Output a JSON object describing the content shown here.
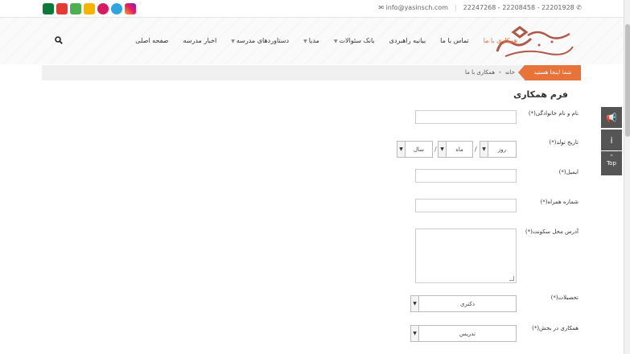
{
  "topbar": {
    "phones": "22247268 - 22208458 - 22201928",
    "email": "info@yasinsch.com",
    "social_icons": [
      "instagram-icon",
      "telegram-icon",
      "aparat-icon",
      "bale-icon",
      "soroush-icon",
      "eitaa-icon",
      "rubika-icon"
    ]
  },
  "nav": {
    "items": [
      {
        "label": "همکاری با ما",
        "active": true
      },
      {
        "label": "تماس با ما"
      },
      {
        "label": "بیانیه راهبردی"
      },
      {
        "label": "بانک سئوالات",
        "dropdown": true
      },
      {
        "label": "مدیا",
        "dropdown": true
      },
      {
        "label": "دستاوردهای مدرسه",
        "dropdown": true
      },
      {
        "label": "اخبار مدرسه"
      },
      {
        "label": "صفحه اصلی"
      }
    ]
  },
  "breadcrumb": {
    "here_label": "شما اینجا هستید",
    "home": "خانه",
    "separator": "›",
    "current": "همکاری با ما"
  },
  "form": {
    "title": "فرم همکاری",
    "fullname_label": "نام و نام خانوادگی(*)",
    "birthdate_label": "تاریخ تولد(*)",
    "day_value": "روز",
    "month_value": "ماه",
    "year_value": "سال",
    "date_sep": "/",
    "email_label": "ایمیل(*)",
    "mobile_label": "شماره همراه(*)",
    "address_label": "آدرس محل سکونت(*)",
    "education_label": "تحصیلات(*)",
    "education_value": "دکتری",
    "department_label": "همکاری در بخش(*)",
    "department_value": "تدریس"
  },
  "side": {
    "top_label": "Top"
  },
  "colors": {
    "accent": "#e8733a",
    "side_widget": "#555555"
  }
}
